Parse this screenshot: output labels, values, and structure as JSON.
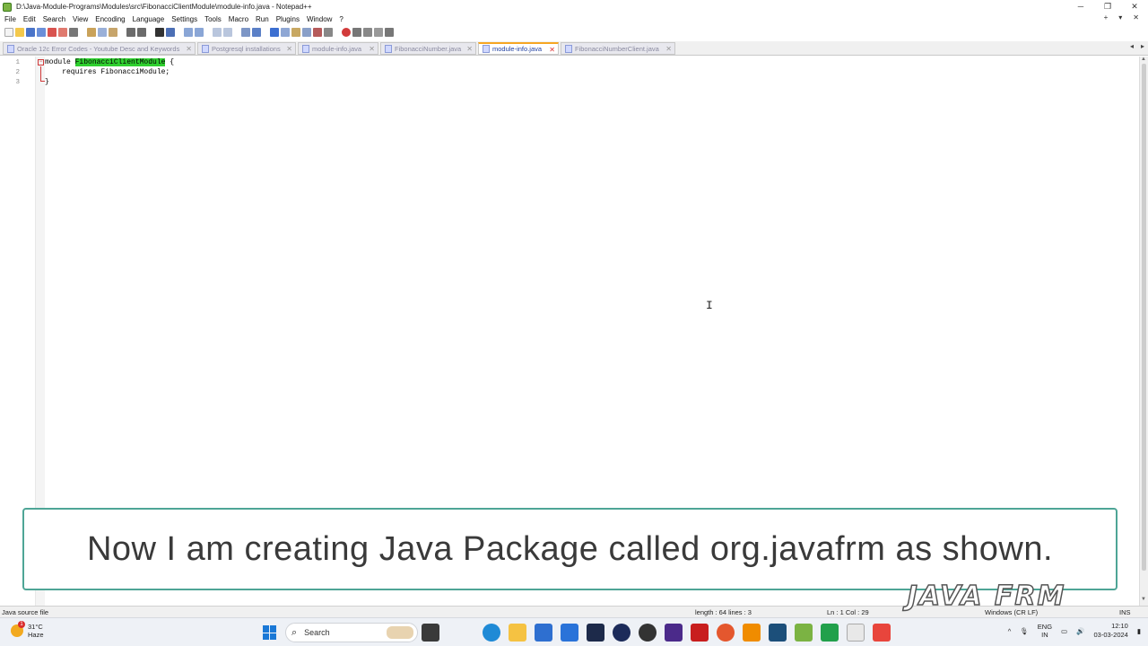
{
  "window": {
    "title": "D:\\Java-Module-Programs\\Modules\\src\\FibonacciClientModule\\module-info.java - Notepad++",
    "minimize": "─",
    "maximize": "❐",
    "close": "✕"
  },
  "menu": {
    "items": [
      "File",
      "Edit",
      "Search",
      "View",
      "Encoding",
      "Language",
      "Settings",
      "Tools",
      "Macro",
      "Run",
      "Plugins",
      "Window",
      "?"
    ],
    "right": [
      "+",
      "▾",
      "✕"
    ]
  },
  "tabs": [
    {
      "label": "Oracle 12c Error Codes - Youtube Desc and Keywords",
      "active": false
    },
    {
      "label": "Postgresql installations",
      "active": false
    },
    {
      "label": "module-info.java",
      "active": false
    },
    {
      "label": "FibonacciNumber.java",
      "active": false
    },
    {
      "label": "module-info.java",
      "active": true
    },
    {
      "label": "FibonacciNumberClient.java",
      "active": false
    }
  ],
  "tab_close": "✕",
  "tab_nav": [
    "◂",
    "▸",
    "✕"
  ],
  "editor": {
    "line_numbers": [
      "1",
      "2",
      "3"
    ],
    "line1_pre": "module ",
    "line1_highlight": "FibonacciClientModule",
    "line1_post": " {",
    "line2": "    requires FibonacciModule;",
    "line3": "}",
    "fold_symbol": "−"
  },
  "caption": "Now I am creating Java Package called org.javafrm as shown.",
  "statusbar": {
    "file_type": "Java source file",
    "length_lines": "length : 64    lines : 3",
    "position": "Ln : 1    Col : 29",
    "line_ending": "Windows (CR LF)",
    "insert_mode": "INS"
  },
  "logo": "JAVA FRM",
  "taskbar": {
    "weather_temp": "31°C",
    "weather_desc": "Haze",
    "weather_badge": "1",
    "search_placeholder": "Search",
    "lang_top": "ENG",
    "lang_bottom": "IN",
    "time": "12:10",
    "date": "03-03-2024"
  },
  "icons": {
    "search": "search-icon",
    "start": "windows-start-icon",
    "cursor": "text-cursor-icon"
  },
  "colors": {
    "highlight": "#2fd02f",
    "active_tab_accent": "#f6a623",
    "caption_border": "#4ea596",
    "fold_marker": "#d03a3a"
  }
}
